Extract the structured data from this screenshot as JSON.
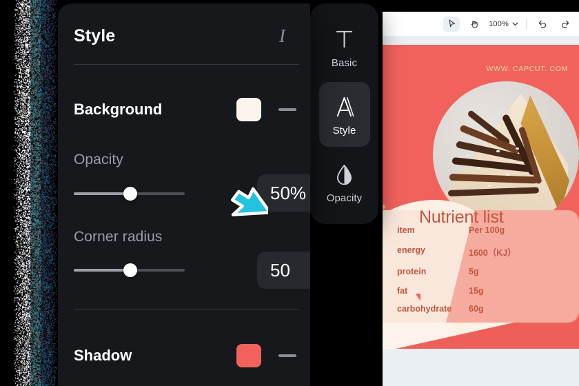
{
  "panel": {
    "title": "Style",
    "italic_icon": "italic-icon",
    "background": {
      "label": "Background",
      "swatch_color": "#faf4ed",
      "toggle_glyph": "—"
    },
    "opacity": {
      "label": "Opacity",
      "value": "50%",
      "slider_percent": 50
    },
    "corner_radius": {
      "label": "Corner radius",
      "value": "50",
      "slider_percent": 50
    },
    "shadow": {
      "label": "Shadow",
      "swatch_color": "#f2625c",
      "toggle_glyph": "—"
    }
  },
  "rail": {
    "items": [
      {
        "label": "Basic",
        "icon": "text-T-icon",
        "active": false
      },
      {
        "label": "Style",
        "icon": "letter-A-icon",
        "active": true
      },
      {
        "label": "Opacity",
        "icon": "droplet-icon",
        "active": false
      }
    ]
  },
  "editor_toolbar": {
    "select_tool": "cursor-arrow-icon",
    "hand_tool": "hand-icon",
    "zoom_level": "100%",
    "zoom_caret": "chevron-down-icon",
    "undo": "undo-icon",
    "redo": "redo-icon"
  },
  "canvas": {
    "watermark": "WWW. CAPCUT. COM",
    "heading": "Nutrient list",
    "table": {
      "rows": [
        {
          "label": "item",
          "value": "Per 100g"
        },
        {
          "label": "energy",
          "value": "1600（KJ）"
        },
        {
          "label": "protein",
          "value": "5g"
        },
        {
          "label": "fat",
          "value": "15g"
        },
        {
          "label": "carbohydrate",
          "value": "60g"
        }
      ]
    },
    "colors": {
      "red": "#f2625c",
      "pink": "#f6ab9f",
      "cream": "#fae7db",
      "title_text": "#c1573f",
      "watermark_text": "#f6d9ae"
    }
  },
  "cursor": {
    "name": "mouse-pointer",
    "fill": "#22c4dd",
    "stroke": "#ffffff"
  }
}
